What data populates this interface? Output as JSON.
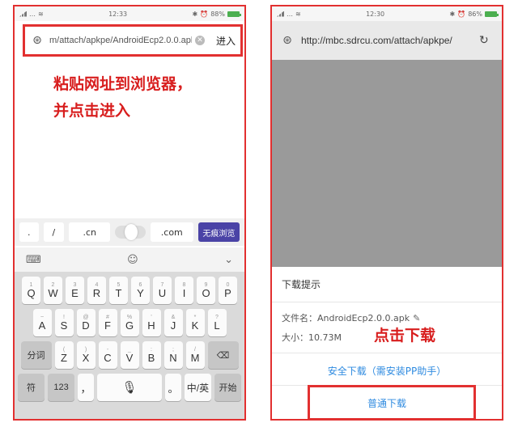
{
  "left": {
    "status": {
      "carrier": "…",
      "time": "12:33",
      "battery": "88%"
    },
    "url": "m/attach/apkpe/AndroidEcp2.0.0.apk",
    "go_label": "进入",
    "instruction_line1": "粘贴网址到浏览器，",
    "instruction_line2": "并点击进入",
    "quick_keys": {
      "dot": ".",
      "slash": "/",
      "cn": ".cn",
      "com": ".com",
      "incognito": "无痕浏览"
    },
    "keyboard": {
      "row1": [
        {
          "main": "Q",
          "sub": "1"
        },
        {
          "main": "W",
          "sub": "2"
        },
        {
          "main": "E",
          "sub": "3"
        },
        {
          "main": "R",
          "sub": "4"
        },
        {
          "main": "T",
          "sub": "5"
        },
        {
          "main": "Y",
          "sub": "6"
        },
        {
          "main": "U",
          "sub": "7"
        },
        {
          "main": "I",
          "sub": "8"
        },
        {
          "main": "O",
          "sub": "9"
        },
        {
          "main": "P",
          "sub": "0"
        }
      ],
      "row2": [
        {
          "main": "A",
          "sub": "~"
        },
        {
          "main": "S",
          "sub": "!"
        },
        {
          "main": "D",
          "sub": "@"
        },
        {
          "main": "F",
          "sub": "#"
        },
        {
          "main": "G",
          "sub": "%"
        },
        {
          "main": "H",
          "sub": "'"
        },
        {
          "main": "J",
          "sub": "&"
        },
        {
          "main": "K",
          "sub": "*"
        },
        {
          "main": "L",
          "sub": "?"
        }
      ],
      "row3_func": "分词",
      "row3": [
        {
          "main": "Z",
          "sub": "("
        },
        {
          "main": "X",
          "sub": ")"
        },
        {
          "main": "C",
          "sub": "-"
        },
        {
          "main": "V",
          "sub": "_"
        },
        {
          "main": "B",
          "sub": ":"
        },
        {
          "main": "N",
          "sub": ";"
        },
        {
          "main": "M",
          "sub": "/"
        }
      ],
      "row4": {
        "symbols": "符",
        "numbers": "123",
        "comma": "，",
        "period": "。",
        "lang": "中/英",
        "start": "开始"
      }
    }
  },
  "right": {
    "status": {
      "carrier": "…",
      "time": "12:30",
      "battery": "86%"
    },
    "url": "http://mbc.sdrcu.com/attach/apkpe/",
    "dialog_title": "下载提示",
    "file_name": "文件名：AndroidEcp2.0.0.apk",
    "file_size": "大小：10.73M",
    "click_hint": "点击下载",
    "safe_download": "安全下载（需安装PP助手）",
    "normal_download": "普通下载"
  }
}
